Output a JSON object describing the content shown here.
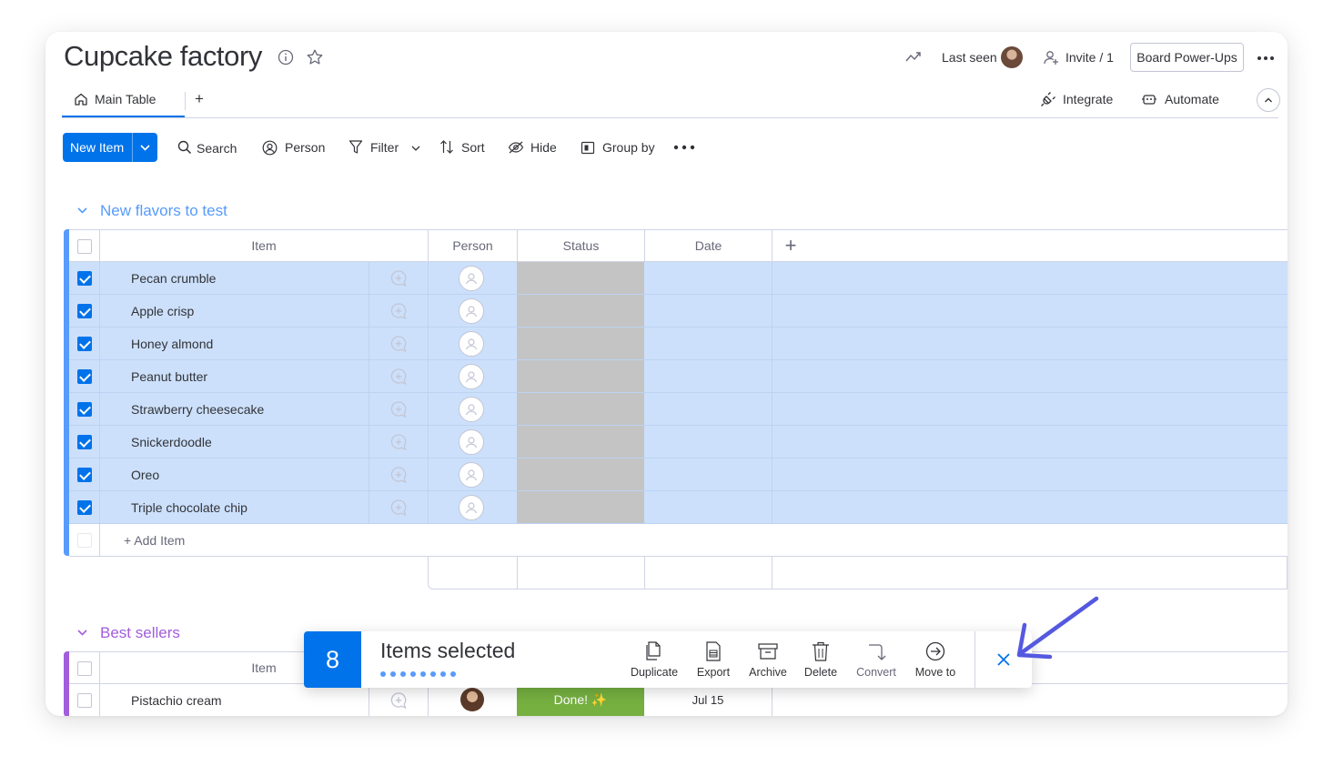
{
  "header": {
    "title": "Cupcake factory",
    "last_seen_label": "Last seen",
    "invite_label": "Invite / 1",
    "power_ups_label": "Board Power-Ups"
  },
  "tabs": {
    "main_table_label": "Main Table",
    "add_view_label": "+",
    "integrate_label": "Integrate",
    "automate_label": "Automate"
  },
  "toolbar": {
    "new_item_label": "New Item",
    "search_label": "Search",
    "person_label": "Person",
    "filter_label": "Filter",
    "sort_label": "Sort",
    "hide_label": "Hide",
    "group_by_label": "Group by"
  },
  "columns": {
    "item": "Item",
    "person": "Person",
    "status": "Status",
    "date": "Date",
    "add": "+"
  },
  "groups": [
    {
      "title": "New flavors to test",
      "color": "#579bfc",
      "add_item_label": "+ Add Item",
      "items": [
        {
          "name": "Pecan crumble",
          "selected": true
        },
        {
          "name": "Apple crisp",
          "selected": true
        },
        {
          "name": "Honey almond",
          "selected": true
        },
        {
          "name": "Peanut butter",
          "selected": true
        },
        {
          "name": "Strawberry cheesecake",
          "selected": true
        },
        {
          "name": "Snickerdoodle",
          "selected": true
        },
        {
          "name": "Oreo",
          "selected": true
        },
        {
          "name": "Triple chocolate chip",
          "selected": true
        }
      ]
    },
    {
      "title": "Best sellers",
      "color": "#a25ddc",
      "items": [
        {
          "name": "Pistachio cream",
          "selected": false,
          "status": "Done! ✨",
          "date": "Jul 15"
        }
      ]
    }
  ],
  "action_bar": {
    "count": "8",
    "label": "Items selected",
    "actions": [
      "Duplicate",
      "Export",
      "Archive",
      "Delete",
      "Convert",
      "Move to"
    ]
  },
  "colors": {
    "primary": "#0073ea",
    "selected_row": "#cce0fb",
    "status_empty": "#c4c4c4",
    "status_done": "#76b041",
    "annotation_arrow": "#5559df"
  }
}
